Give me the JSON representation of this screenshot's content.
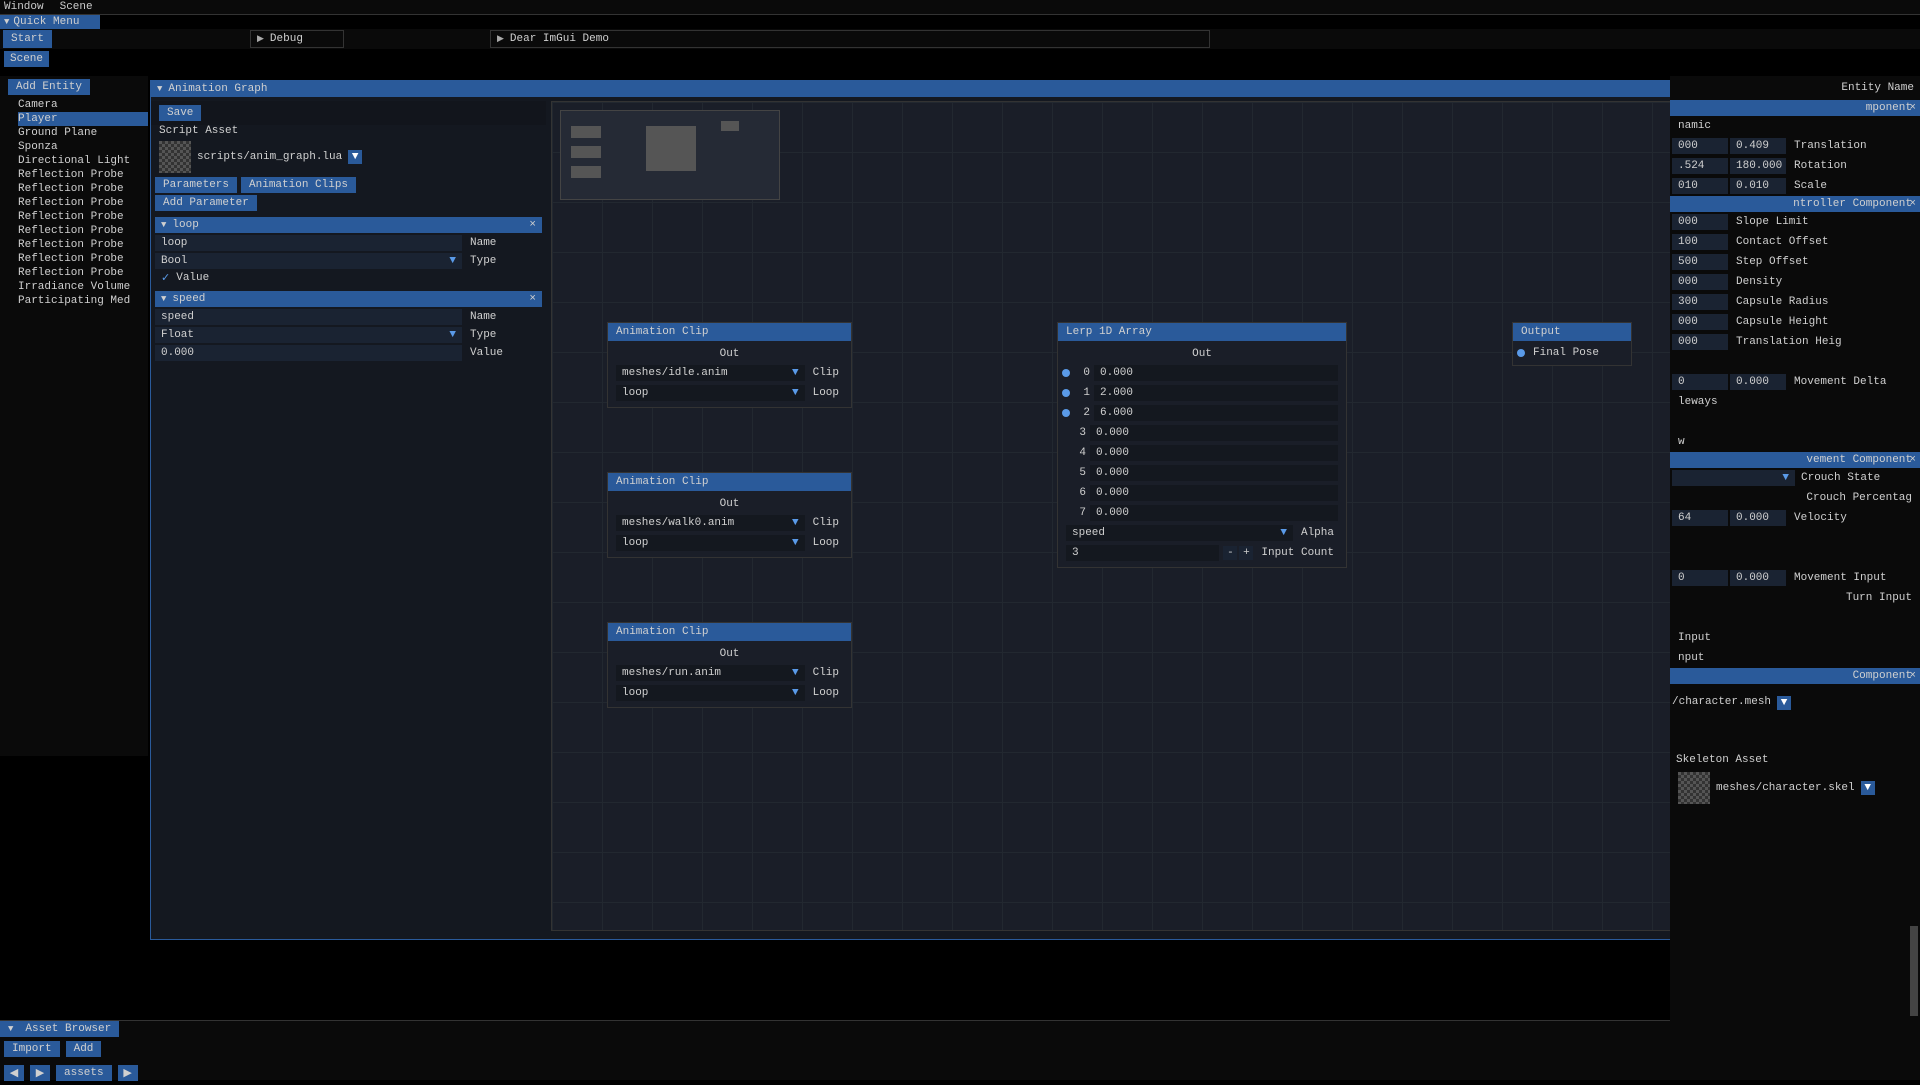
{
  "menubar": {
    "window": "Window",
    "scene": "Scene"
  },
  "quickmenu": "Quick Menu",
  "toolbar": {
    "start": "Start",
    "debug": "Debug",
    "demo": "Dear ImGui Demo"
  },
  "scene": {
    "title": "Scene",
    "add": "Add Entity",
    "items": [
      "Camera",
      "Player",
      "Ground Plane",
      "Sponza",
      "Directional Light",
      "Reflection Probe",
      "Reflection Probe",
      "Reflection Probe",
      "Reflection Probe",
      "Reflection Probe",
      "Reflection Probe",
      "Reflection Probe",
      "Reflection Probe",
      "Irradiance Volume",
      "Participating Med"
    ]
  },
  "anim": {
    "title": "Animation Graph",
    "save": "Save",
    "script_asset": "Script Asset",
    "script_path": "scripts/anim_graph.lua",
    "tabs": {
      "params": "Parameters",
      "clips": "Animation Clips"
    },
    "add_param": "Add Parameter",
    "params": [
      {
        "name": "loop",
        "name_lbl": "Name",
        "type": "Bool",
        "type_lbl": "Type",
        "val_lbl": "Value",
        "checked": true
      },
      {
        "name": "speed",
        "name_lbl": "Name",
        "type": "Float",
        "type_lbl": "Type",
        "val": "0.000",
        "val_lbl": "Value"
      }
    ]
  },
  "nodes": {
    "clip1": {
      "title": "Animation Clip",
      "out": "Out",
      "clip": "meshes/idle.anim",
      "clip_lbl": "Clip",
      "loop": "loop",
      "loop_lbl": "Loop"
    },
    "clip2": {
      "title": "Animation Clip",
      "out": "Out",
      "clip": "meshes/walk0.anim",
      "clip_lbl": "Clip",
      "loop": "loop",
      "loop_lbl": "Loop"
    },
    "clip3": {
      "title": "Animation Clip",
      "out": "Out",
      "clip": "meshes/run.anim",
      "clip_lbl": "Clip",
      "loop": "loop",
      "loop_lbl": "Loop"
    },
    "lerp": {
      "title": "Lerp 1D Array",
      "out": "Out",
      "vals": [
        "0.000",
        "2.000",
        "6.000",
        "0.000",
        "0.000",
        "0.000",
        "0.000",
        "0.000"
      ],
      "alpha": "speed",
      "alpha_lbl": "Alpha",
      "count": "3",
      "count_lbl": "Input Count"
    },
    "output": {
      "title": "Output",
      "pose": "Final Pose"
    }
  },
  "inspector": {
    "entity_name": "Entity Name",
    "comp1": "mponent",
    "dynamic": "namic",
    "trans": [
      "000",
      "0.409"
    ],
    "trans_lbl": "Translation",
    "rot": [
      ".524",
      "180.000"
    ],
    "rot_lbl": "Rotation",
    "scale": [
      "010",
      "0.010"
    ],
    "scale_lbl": "Scale",
    "ctrl": "ntroller Component",
    "slope": "000",
    "slope_lbl": "Slope Limit",
    "contact": "100",
    "contact_lbl": "Contact Offset",
    "step": "500",
    "step_lbl": "Step Offset",
    "density": "000",
    "density_lbl": "Density",
    "radius": "300",
    "radius_lbl": "Capsule Radius",
    "height": "000",
    "height_lbl": "Capsule Height",
    "theight": "000",
    "theight_lbl": "Translation Heig",
    "mvdelta": [
      "0",
      "0.000"
    ],
    "mvdelta_lbl": "Movement Delta",
    "leways": "leways",
    "w": "w",
    "vcomp": "vement Component",
    "crouch_state": "Crouch State",
    "crouch_pct": "Crouch Percentag",
    "vel": [
      "64",
      "0.000"
    ],
    "vel_lbl": "Velocity",
    "mvinput": [
      "0",
      "0.000"
    ],
    "mvinput_lbl": "Movement Input",
    "turn": "Turn Input",
    "input": "Input",
    "nput": "nput",
    "component": "Component",
    "mesh": "/character.mesh",
    "skel_asset": "Skeleton Asset",
    "skel": "meshes/character.skel"
  },
  "asset_browser": {
    "title": "Asset Browser",
    "import": "Import",
    "add": "Add",
    "path": "assets"
  }
}
